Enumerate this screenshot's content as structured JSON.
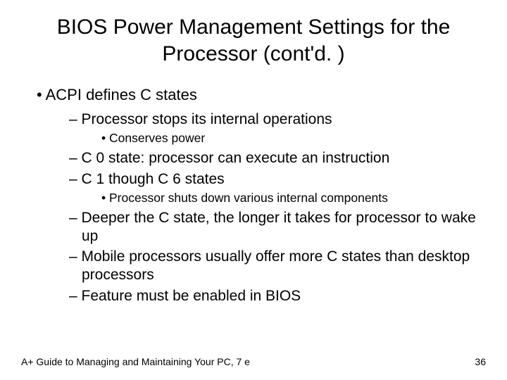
{
  "title": "BIOS Power Management Settings for the Processor (cont'd. )",
  "b1": "ACPI defines C states",
  "b1_1": "Processor stops its internal operations",
  "b1_1_1": "Conserves power",
  "b1_2": "C 0 state: processor can execute an instruction",
  "b1_3": "C 1 though C 6 states",
  "b1_3_1": "Processor shuts down various internal components",
  "b1_4": "Deeper the C state, the longer it takes for processor to wake up",
  "b1_5": "Mobile processors usually offer more C states than desktop processors",
  "b1_6": "Feature must be enabled in BIOS",
  "footer_left": "A+ Guide to Managing and Maintaining Your PC, 7 e",
  "footer_right": "36"
}
